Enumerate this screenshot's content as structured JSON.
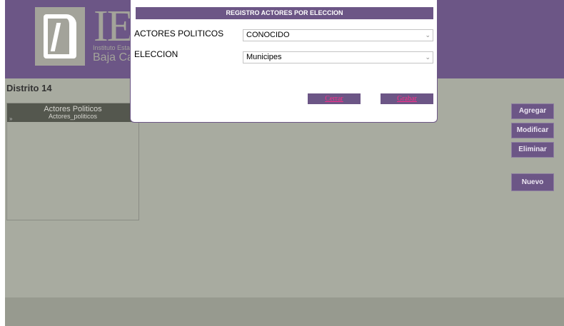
{
  "header": {
    "logo_letters": "IE",
    "logo_line1": "Instituto Estatal",
    "logo_line2": "Baja Cal"
  },
  "page": {
    "district": "Distrito 14"
  },
  "list": {
    "title": "Actores Politicos",
    "subtitle": "Actores_politicos",
    "arrow": "»"
  },
  "side_buttons": {
    "agregar": "Agregar",
    "modificar": "Modificar",
    "eliminar": "Eliminar",
    "nuevo": "Nuevo"
  },
  "dialog": {
    "title": "REGISTRO ACTORES POR ELECCION",
    "actores_label": "ACTORES POLITICOS",
    "actores_value": "CONOCIDO",
    "eleccion_label": "ELECCION",
    "eleccion_value": "Municipes",
    "cerrar": "Cerrar",
    "grabar": "Grabar",
    "chevron": "⌄"
  },
  "colors": {
    "brand_purple": "#6c5686",
    "background_gray": "#a8aba0",
    "link_pink": "#ff2d8a"
  }
}
